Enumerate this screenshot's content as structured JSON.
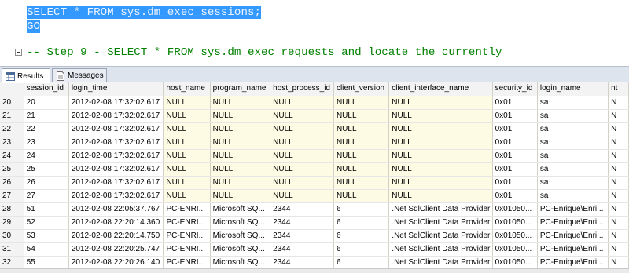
{
  "editor": {
    "line1": "SELECT * FROM sys.dm_exec_sessions;",
    "line2": "GO",
    "comment": "-- Step 9 - SELECT * FROM sys.dm_exec_requests and locate the currently"
  },
  "tabs": [
    {
      "label": "Results"
    },
    {
      "label": "Messages"
    }
  ],
  "columns": [
    "",
    "session_id",
    "login_time",
    "host_name",
    "program_name",
    "host_process_id",
    "client_version",
    "client_interface_name",
    "security_id",
    "login_name",
    "nt"
  ],
  "rows": [
    {
      "n": "20",
      "cells": [
        "20",
        "2012-02-08 17:32:02.617",
        "NULL",
        "NULL",
        "NULL",
        "NULL",
        "NULL",
        "0x01",
        "sa",
        "N"
      ]
    },
    {
      "n": "21",
      "cells": [
        "21",
        "2012-02-08 17:32:02.617",
        "NULL",
        "NULL",
        "NULL",
        "NULL",
        "NULL",
        "0x01",
        "sa",
        "N"
      ]
    },
    {
      "n": "22",
      "cells": [
        "22",
        "2012-02-08 17:32:02.617",
        "NULL",
        "NULL",
        "NULL",
        "NULL",
        "NULL",
        "0x01",
        "sa",
        "N"
      ]
    },
    {
      "n": "23",
      "cells": [
        "23",
        "2012-02-08 17:32:02.617",
        "NULL",
        "NULL",
        "NULL",
        "NULL",
        "NULL",
        "0x01",
        "sa",
        "N"
      ]
    },
    {
      "n": "24",
      "cells": [
        "24",
        "2012-02-08 17:32:02.617",
        "NULL",
        "NULL",
        "NULL",
        "NULL",
        "NULL",
        "0x01",
        "sa",
        "N"
      ]
    },
    {
      "n": "25",
      "cells": [
        "25",
        "2012-02-08 17:32:02.617",
        "NULL",
        "NULL",
        "NULL",
        "NULL",
        "NULL",
        "0x01",
        "sa",
        "N"
      ]
    },
    {
      "n": "26",
      "cells": [
        "26",
        "2012-02-08 17:32:02.617",
        "NULL",
        "NULL",
        "NULL",
        "NULL",
        "NULL",
        "0x01",
        "sa",
        "N"
      ]
    },
    {
      "n": "27",
      "cells": [
        "27",
        "2012-02-08 17:32:02.617",
        "NULL",
        "NULL",
        "NULL",
        "NULL",
        "NULL",
        "0x01",
        "sa",
        "N"
      ]
    },
    {
      "n": "28",
      "cells": [
        "51",
        "2012-02-08 22:05:37.767",
        "PC-ENRI...",
        "Microsoft SQ...",
        "2344",
        "6",
        ".Net SqlClient Data Provider",
        "0x01050...",
        "PC-Enrique\\Enri...",
        "N"
      ]
    },
    {
      "n": "29",
      "cells": [
        "52",
        "2012-02-08 22:20:14.360",
        "PC-ENRI...",
        "Microsoft SQ...",
        "2344",
        "6",
        ".Net SqlClient Data Provider",
        "0x01050...",
        "PC-Enrique\\Enri...",
        "N"
      ]
    },
    {
      "n": "30",
      "cells": [
        "53",
        "2012-02-08 22:20:14.750",
        "PC-ENRI...",
        "Microsoft SQ...",
        "2344",
        "6",
        ".Net SqlClient Data Provider",
        "0x01050...",
        "PC-Enrique\\Enri...",
        "N"
      ]
    },
    {
      "n": "31",
      "cells": [
        "54",
        "2012-02-08 22:20:25.747",
        "PC-ENRI...",
        "Microsoft SQ...",
        "2344",
        "6",
        ".Net SqlClient Data Provider",
        "0x01050...",
        "PC-Enrique\\Enri...",
        "N"
      ]
    },
    {
      "n": "32",
      "cells": [
        "55",
        "2012-02-08 22:20:26.140",
        "PC-ENRI...",
        "Microsoft SQ...",
        "2344",
        "6",
        ".Net SqlClient Data Provider",
        "0x01050...",
        "PC-Enrique\\Enri...",
        "N"
      ]
    }
  ],
  "colors": {
    "selection": "#3399ff",
    "comment": "#008000",
    "highlight_cell": "#fdfbe3",
    "header": "#f3f3f3"
  },
  "icons": {
    "results_tab": "grid-icon",
    "messages_tab": "document-icon"
  }
}
